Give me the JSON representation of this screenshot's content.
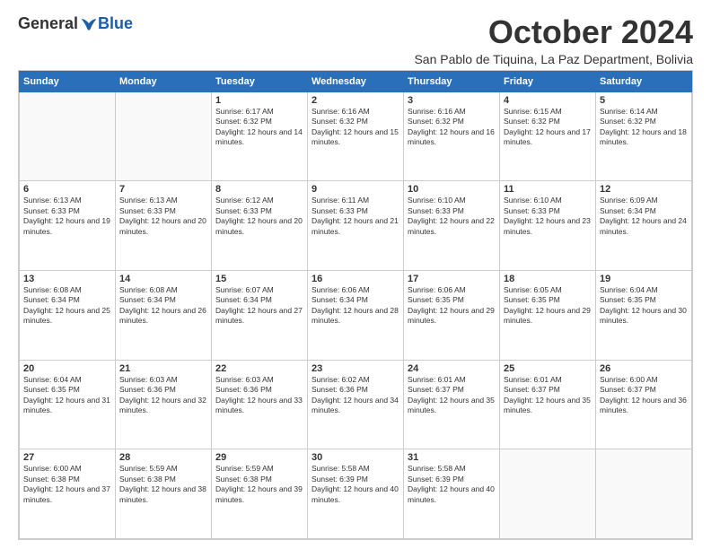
{
  "logo": {
    "general": "General",
    "blue": "Blue"
  },
  "title": "October 2024",
  "location": "San Pablo de Tiquina, La Paz Department, Bolivia",
  "days_of_week": [
    "Sunday",
    "Monday",
    "Tuesday",
    "Wednesday",
    "Thursday",
    "Friday",
    "Saturday"
  ],
  "weeks": [
    [
      {
        "day": "",
        "sunrise": "",
        "sunset": "",
        "daylight": ""
      },
      {
        "day": "",
        "sunrise": "",
        "sunset": "",
        "daylight": ""
      },
      {
        "day": "1",
        "sunrise": "Sunrise: 6:17 AM",
        "sunset": "Sunset: 6:32 PM",
        "daylight": "Daylight: 12 hours and 14 minutes."
      },
      {
        "day": "2",
        "sunrise": "Sunrise: 6:16 AM",
        "sunset": "Sunset: 6:32 PM",
        "daylight": "Daylight: 12 hours and 15 minutes."
      },
      {
        "day": "3",
        "sunrise": "Sunrise: 6:16 AM",
        "sunset": "Sunset: 6:32 PM",
        "daylight": "Daylight: 12 hours and 16 minutes."
      },
      {
        "day": "4",
        "sunrise": "Sunrise: 6:15 AM",
        "sunset": "Sunset: 6:32 PM",
        "daylight": "Daylight: 12 hours and 17 minutes."
      },
      {
        "day": "5",
        "sunrise": "Sunrise: 6:14 AM",
        "sunset": "Sunset: 6:32 PM",
        "daylight": "Daylight: 12 hours and 18 minutes."
      }
    ],
    [
      {
        "day": "6",
        "sunrise": "Sunrise: 6:13 AM",
        "sunset": "Sunset: 6:33 PM",
        "daylight": "Daylight: 12 hours and 19 minutes."
      },
      {
        "day": "7",
        "sunrise": "Sunrise: 6:13 AM",
        "sunset": "Sunset: 6:33 PM",
        "daylight": "Daylight: 12 hours and 20 minutes."
      },
      {
        "day": "8",
        "sunrise": "Sunrise: 6:12 AM",
        "sunset": "Sunset: 6:33 PM",
        "daylight": "Daylight: 12 hours and 20 minutes."
      },
      {
        "day": "9",
        "sunrise": "Sunrise: 6:11 AM",
        "sunset": "Sunset: 6:33 PM",
        "daylight": "Daylight: 12 hours and 21 minutes."
      },
      {
        "day": "10",
        "sunrise": "Sunrise: 6:10 AM",
        "sunset": "Sunset: 6:33 PM",
        "daylight": "Daylight: 12 hours and 22 minutes."
      },
      {
        "day": "11",
        "sunrise": "Sunrise: 6:10 AM",
        "sunset": "Sunset: 6:33 PM",
        "daylight": "Daylight: 12 hours and 23 minutes."
      },
      {
        "day": "12",
        "sunrise": "Sunrise: 6:09 AM",
        "sunset": "Sunset: 6:34 PM",
        "daylight": "Daylight: 12 hours and 24 minutes."
      }
    ],
    [
      {
        "day": "13",
        "sunrise": "Sunrise: 6:08 AM",
        "sunset": "Sunset: 6:34 PM",
        "daylight": "Daylight: 12 hours and 25 minutes."
      },
      {
        "day": "14",
        "sunrise": "Sunrise: 6:08 AM",
        "sunset": "Sunset: 6:34 PM",
        "daylight": "Daylight: 12 hours and 26 minutes."
      },
      {
        "day": "15",
        "sunrise": "Sunrise: 6:07 AM",
        "sunset": "Sunset: 6:34 PM",
        "daylight": "Daylight: 12 hours and 27 minutes."
      },
      {
        "day": "16",
        "sunrise": "Sunrise: 6:06 AM",
        "sunset": "Sunset: 6:34 PM",
        "daylight": "Daylight: 12 hours and 28 minutes."
      },
      {
        "day": "17",
        "sunrise": "Sunrise: 6:06 AM",
        "sunset": "Sunset: 6:35 PM",
        "daylight": "Daylight: 12 hours and 29 minutes."
      },
      {
        "day": "18",
        "sunrise": "Sunrise: 6:05 AM",
        "sunset": "Sunset: 6:35 PM",
        "daylight": "Daylight: 12 hours and 29 minutes."
      },
      {
        "day": "19",
        "sunrise": "Sunrise: 6:04 AM",
        "sunset": "Sunset: 6:35 PM",
        "daylight": "Daylight: 12 hours and 30 minutes."
      }
    ],
    [
      {
        "day": "20",
        "sunrise": "Sunrise: 6:04 AM",
        "sunset": "Sunset: 6:35 PM",
        "daylight": "Daylight: 12 hours and 31 minutes."
      },
      {
        "day": "21",
        "sunrise": "Sunrise: 6:03 AM",
        "sunset": "Sunset: 6:36 PM",
        "daylight": "Daylight: 12 hours and 32 minutes."
      },
      {
        "day": "22",
        "sunrise": "Sunrise: 6:03 AM",
        "sunset": "Sunset: 6:36 PM",
        "daylight": "Daylight: 12 hours and 33 minutes."
      },
      {
        "day": "23",
        "sunrise": "Sunrise: 6:02 AM",
        "sunset": "Sunset: 6:36 PM",
        "daylight": "Daylight: 12 hours and 34 minutes."
      },
      {
        "day": "24",
        "sunrise": "Sunrise: 6:01 AM",
        "sunset": "Sunset: 6:37 PM",
        "daylight": "Daylight: 12 hours and 35 minutes."
      },
      {
        "day": "25",
        "sunrise": "Sunrise: 6:01 AM",
        "sunset": "Sunset: 6:37 PM",
        "daylight": "Daylight: 12 hours and 35 minutes."
      },
      {
        "day": "26",
        "sunrise": "Sunrise: 6:00 AM",
        "sunset": "Sunset: 6:37 PM",
        "daylight": "Daylight: 12 hours and 36 minutes."
      }
    ],
    [
      {
        "day": "27",
        "sunrise": "Sunrise: 6:00 AM",
        "sunset": "Sunset: 6:38 PM",
        "daylight": "Daylight: 12 hours and 37 minutes."
      },
      {
        "day": "28",
        "sunrise": "Sunrise: 5:59 AM",
        "sunset": "Sunset: 6:38 PM",
        "daylight": "Daylight: 12 hours and 38 minutes."
      },
      {
        "day": "29",
        "sunrise": "Sunrise: 5:59 AM",
        "sunset": "Sunset: 6:38 PM",
        "daylight": "Daylight: 12 hours and 39 minutes."
      },
      {
        "day": "30",
        "sunrise": "Sunrise: 5:58 AM",
        "sunset": "Sunset: 6:39 PM",
        "daylight": "Daylight: 12 hours and 40 minutes."
      },
      {
        "day": "31",
        "sunrise": "Sunrise: 5:58 AM",
        "sunset": "Sunset: 6:39 PM",
        "daylight": "Daylight: 12 hours and 40 minutes."
      },
      {
        "day": "",
        "sunrise": "",
        "sunset": "",
        "daylight": ""
      },
      {
        "day": "",
        "sunrise": "",
        "sunset": "",
        "daylight": ""
      }
    ]
  ]
}
